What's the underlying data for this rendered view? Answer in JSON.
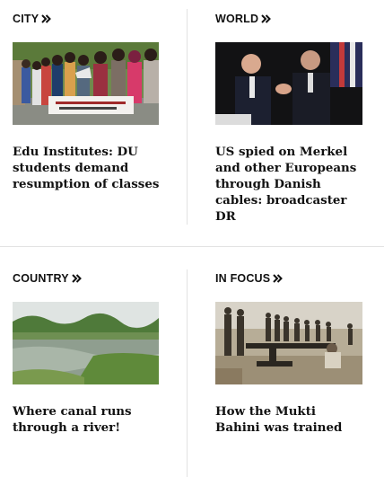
{
  "cards": [
    {
      "section": "CITY",
      "headline": "Edu Institutes: DU students demand resumption of classes"
    },
    {
      "section": "WORLD",
      "headline": "US spied on Merkel and other Europeans through Danish cables: broadcaster DR"
    },
    {
      "section": "COUNTRY",
      "headline": "Where canal runs through a river!"
    },
    {
      "section": "IN FOCUS",
      "headline": "How the Mukti Bahini was trained"
    }
  ],
  "icons": {
    "section_arrow": "double-chevron-right-icon"
  },
  "colors": {
    "text": "#111111",
    "divider": "#e2e2e2",
    "background": "#ffffff"
  }
}
